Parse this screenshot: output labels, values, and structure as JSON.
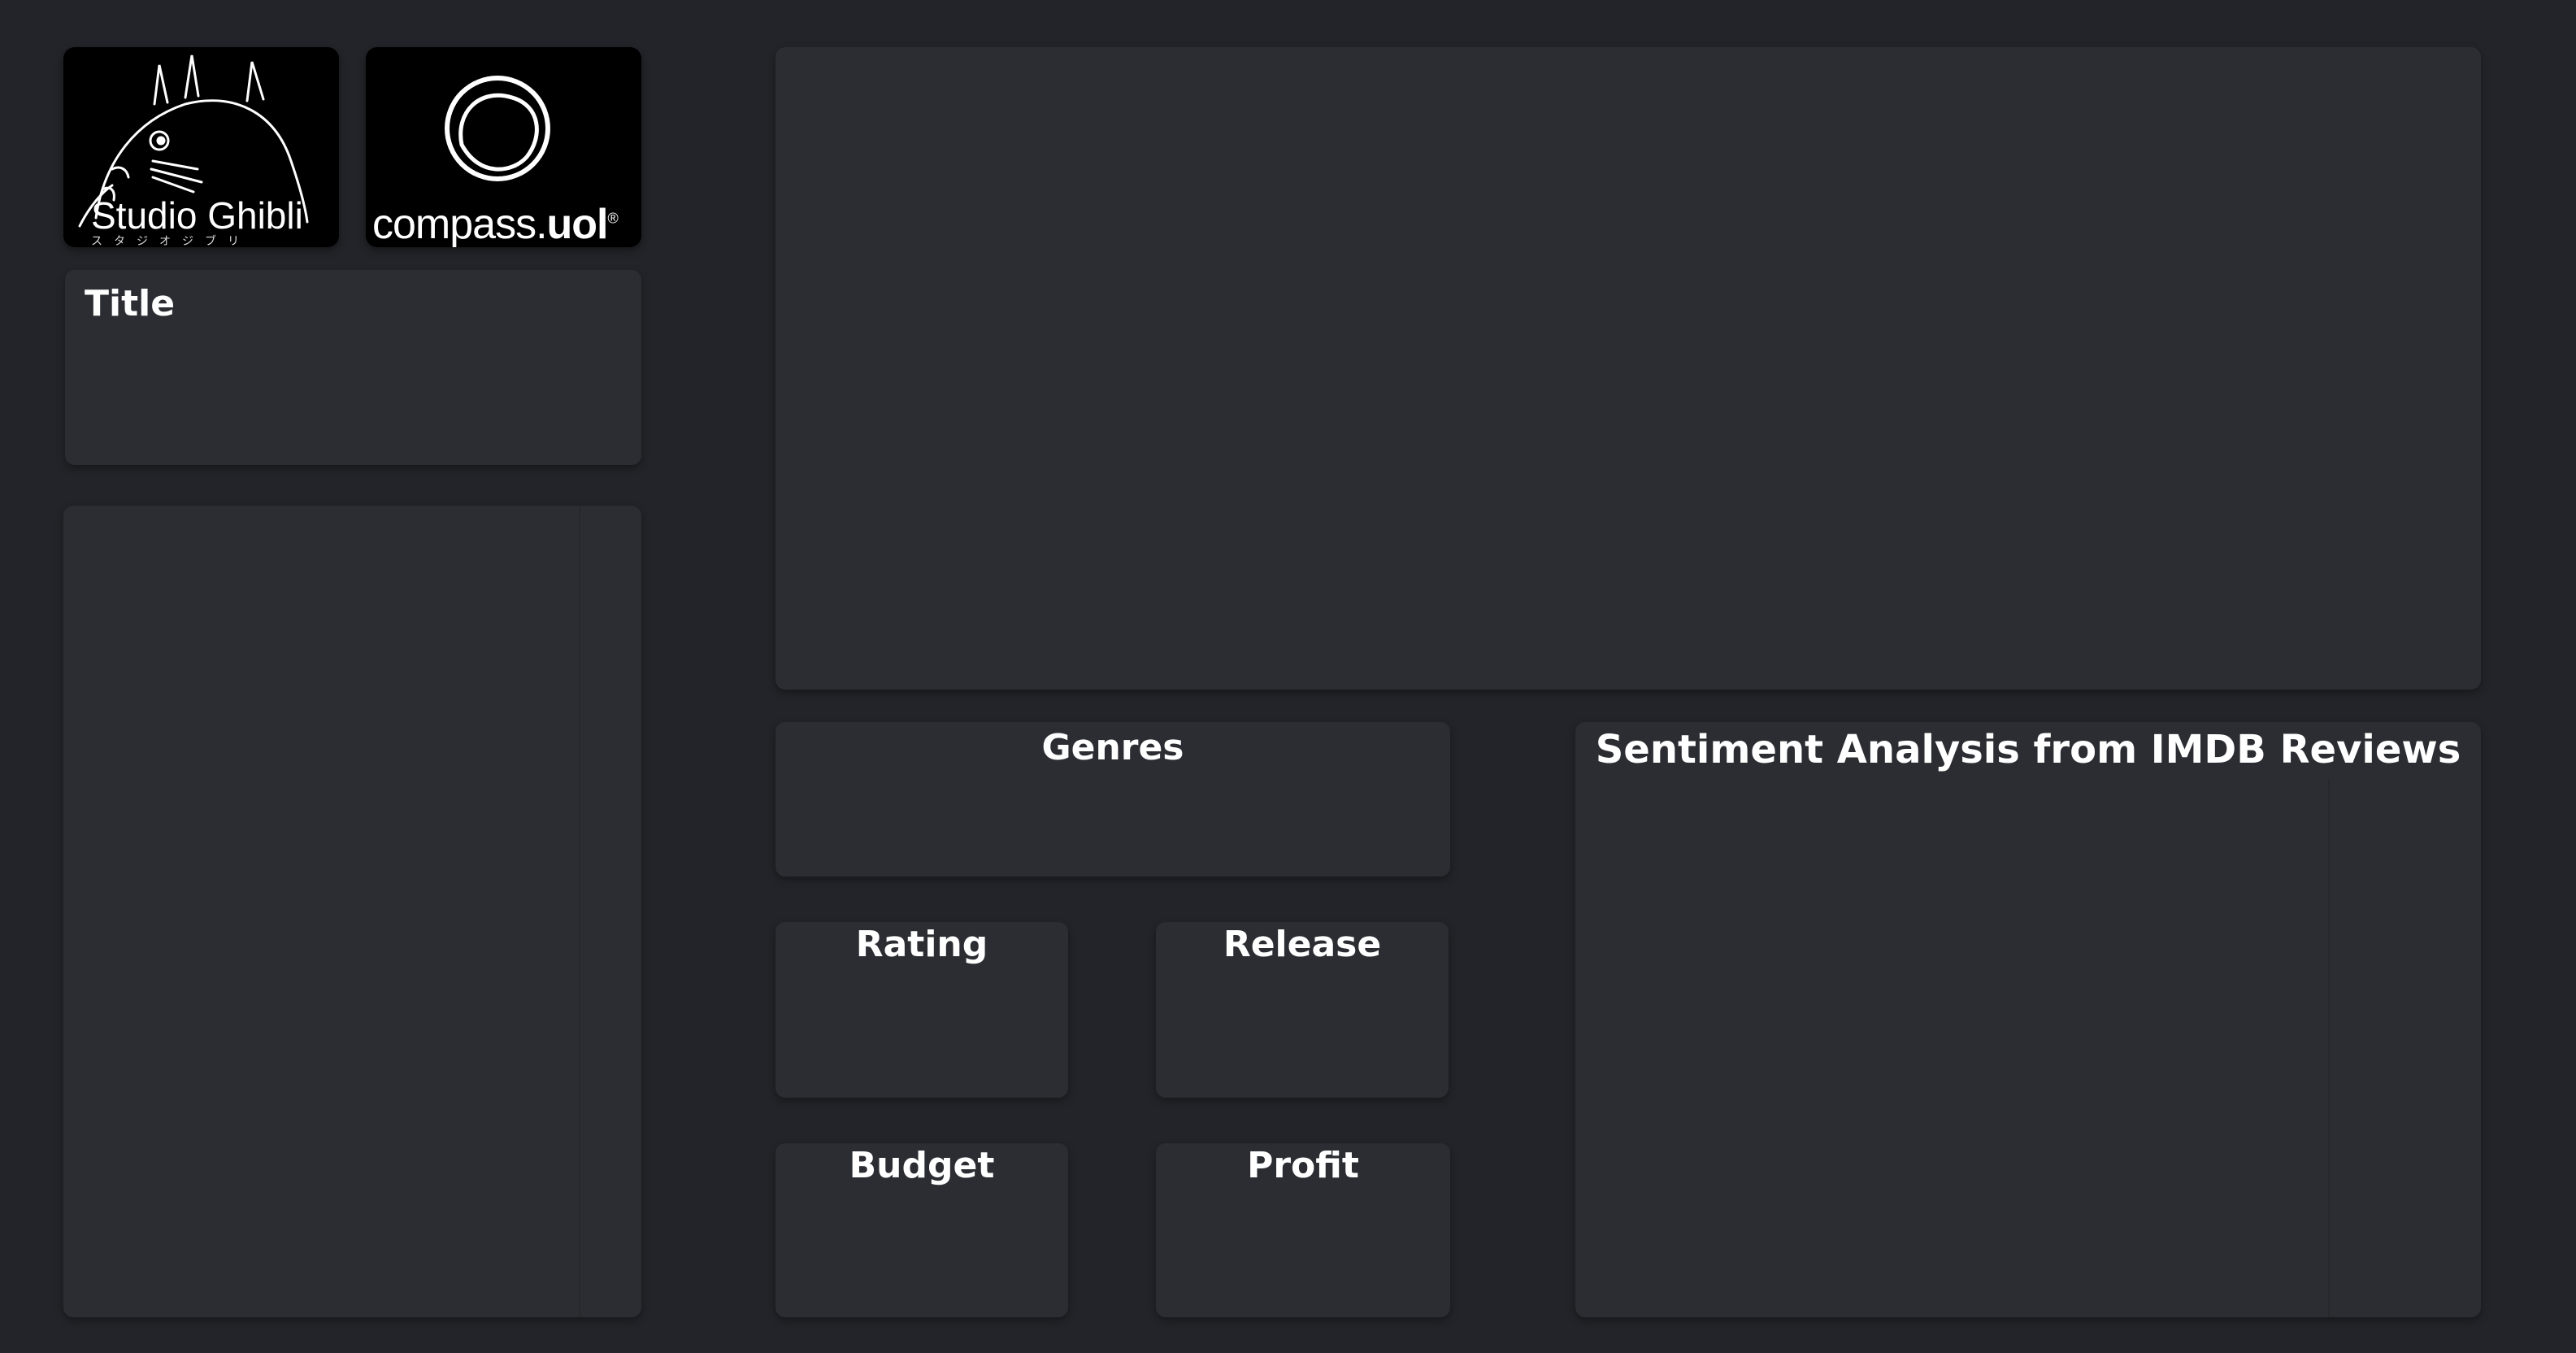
{
  "logos": {
    "ghibli": {
      "name": "Studio Ghibli",
      "subtitle": "スタジオジブリ"
    },
    "compass": {
      "prefix": "compass.",
      "suffix": "uol",
      "registered": "®"
    }
  },
  "filters": {
    "title_label": "Title"
  },
  "cards": {
    "genres": "Genres",
    "rating": "Rating",
    "release": "Release",
    "budget": "Budget",
    "profit": "Profit",
    "sentiment": "Sentiment Analysis from IMDB Reviews"
  },
  "colors": {
    "background": "#222429",
    "panel": "#2b2d32",
    "text": "#ffffff",
    "logo_bg": "#000000"
  }
}
